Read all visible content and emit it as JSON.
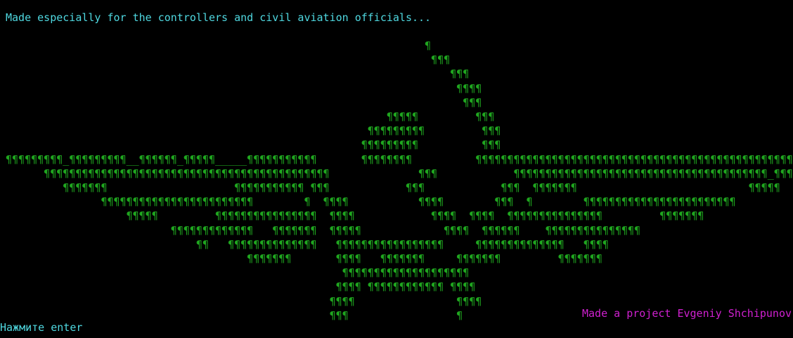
{
  "console": {
    "tagline": "Made especially for the controllers and civil aviation officials...",
    "ascii_art": "                                                                  ¶\n                                                                   ¶¶¶\n                                                                      ¶¶¶\n                                                                       ¶¶¶¶\n                                                                        ¶¶¶\n                                                            ¶¶¶¶¶         ¶¶¶\n                                                         ¶¶¶¶¶¶¶¶¶         ¶¶¶\n                                                        ¶¶¶¶¶¶¶¶¶          ¶¶¶\n¶¶¶¶¶¶¶¶¶_¶¶¶¶¶¶¶¶¶__¶¶¶¶¶¶_¶¶¶¶¶_____¶¶¶¶¶¶¶¶¶¶¶       ¶¶¶¶¶¶¶¶          ¶¶¶¶¶¶¶¶¶¶¶¶¶¶¶¶¶¶¶¶¶¶¶¶¶¶¶¶¶¶¶¶¶¶¶¶¶¶¶¶¶¶¶¶¶¶¶¶¶¶¶\n      ¶¶¶¶¶¶¶¶¶¶¶¶¶¶¶¶¶¶¶¶¶¶¶¶¶¶¶¶¶¶¶¶¶¶¶¶¶¶¶¶¶¶¶¶¶              ¶¶¶            ¶¶¶¶¶¶¶¶¶¶¶¶¶¶¶¶¶¶¶¶¶¶¶¶¶¶¶¶¶¶¶¶¶¶¶¶¶¶¶¶_¶¶¶¶¶\n         ¶¶¶¶¶¶¶                    ¶¶¶¶¶¶¶¶¶¶¶ ¶¶¶            ¶¶¶            ¶¶¶  ¶¶¶¶¶¶¶                           ¶¶¶¶¶\n               ¶¶¶¶¶¶¶¶¶¶¶¶¶¶¶¶¶¶¶¶¶¶¶¶        ¶  ¶¶¶¶           ¶¶¶¶        ¶¶¶  ¶        ¶¶¶¶¶¶¶¶¶¶¶¶¶¶¶¶¶¶¶¶¶¶¶¶\n                   ¶¶¶¶¶         ¶¶¶¶¶¶¶¶¶¶¶¶¶¶¶¶  ¶¶¶¶            ¶¶¶¶  ¶¶¶¶  ¶¶¶¶¶¶¶¶¶¶¶¶¶¶¶         ¶¶¶¶¶¶¶\n                          ¶¶¶¶¶¶¶¶¶¶¶¶¶   ¶¶¶¶¶¶¶  ¶¶¶¶¶             ¶¶¶¶  ¶¶¶¶¶¶    ¶¶¶¶¶¶¶¶¶¶¶¶¶¶¶\n                              ¶¶   ¶¶¶¶¶¶¶¶¶¶¶¶¶¶   ¶¶¶¶¶¶¶¶¶¶¶¶¶¶¶¶¶     ¶¶¶¶¶¶¶¶¶¶¶¶¶¶   ¶¶¶¶\n                                      ¶¶¶¶¶¶¶       ¶¶¶¶   ¶¶¶¶¶¶¶     ¶¶¶¶¶¶¶         ¶¶¶¶¶¶¶\n                                                     ¶¶¶¶¶¶¶¶¶¶¶¶¶¶¶¶¶¶¶¶\n                                                    ¶¶¶¶ ¶¶¶¶¶¶¶¶¶¶¶¶ ¶¶¶¶\n                                                   ¶¶¶¶                ¶¶¶¶\n                                                   ¶¶¶                 ¶",
    "credit": "Made a project Evgeniy Shchipunov",
    "prompt": "Нажмите enter"
  },
  "colors": {
    "background": "#000000",
    "cyan_text": "#4fd8e0",
    "art_green": "#1fa51f",
    "credit_magenta": "#d020d0"
  }
}
